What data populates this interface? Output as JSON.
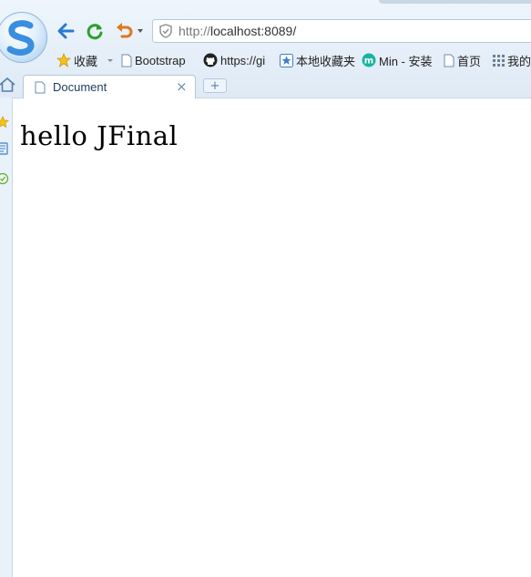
{
  "toolbar": {
    "url_prefix": "http://",
    "url_host": "localhost:8089/"
  },
  "bookmarks": [
    {
      "label": "收藏",
      "icon": "star-icon"
    },
    {
      "label": "Bootstrap",
      "icon": "page-icon"
    },
    {
      "label": "https://gi",
      "icon": "github-icon"
    },
    {
      "label": "本地收藏夹",
      "icon": "star-box-icon"
    },
    {
      "label": "Min - 安装",
      "icon": "min-icon"
    },
    {
      "label": "首页",
      "icon": "page-icon"
    },
    {
      "label": "我的",
      "icon": "apps-grid-icon"
    }
  ],
  "tabs": [
    {
      "label": "Document",
      "close": "×"
    }
  ],
  "new_tab_label": "+",
  "page": {
    "heading": "hello JFinal"
  },
  "colors": {
    "accent_blue": "#2a7bd2",
    "refresh_green": "#2aa12a",
    "undo_orange": "#e0781a"
  }
}
